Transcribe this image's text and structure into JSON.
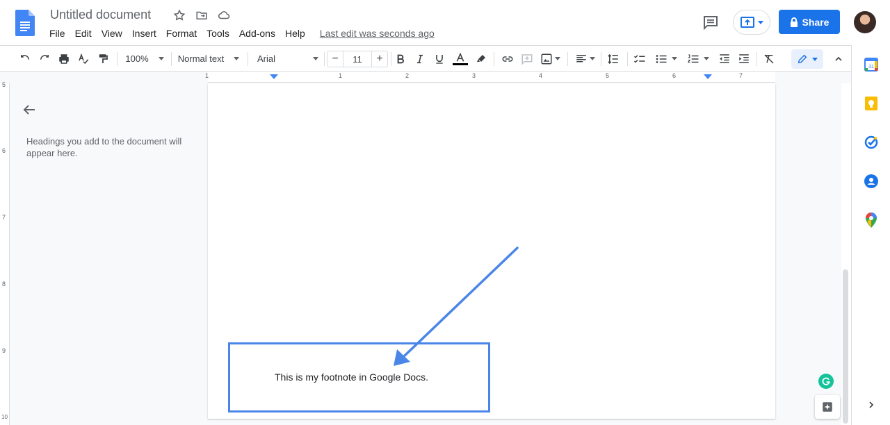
{
  "app": {
    "title": "Untitled document",
    "last_edit": "Last edit was seconds ago"
  },
  "menu": [
    "File",
    "Edit",
    "View",
    "Insert",
    "Format",
    "Tools",
    "Add-ons",
    "Help"
  ],
  "header": {
    "share_label": "Share"
  },
  "toolbar": {
    "zoom": "100%",
    "style": "Normal text",
    "font": "Arial",
    "font_size": "11",
    "minus": "−",
    "plus": "+"
  },
  "ruler": {
    "labels": [
      "1",
      "1",
      "2",
      "3",
      "4",
      "5",
      "6",
      "7"
    ]
  },
  "vruler": {
    "labels": [
      "5",
      "6",
      "7",
      "8",
      "9",
      "10"
    ]
  },
  "outline": {
    "empty_text": "Headings you add to the document will appear here."
  },
  "document": {
    "footnote_text": "This is my footnote in Google Docs."
  },
  "annotation": {
    "box_color": "#4a86e8",
    "arrow_color": "#4a86e8"
  },
  "colors": {
    "accent": "#1a73e8",
    "text_color_bar": "#000000"
  }
}
